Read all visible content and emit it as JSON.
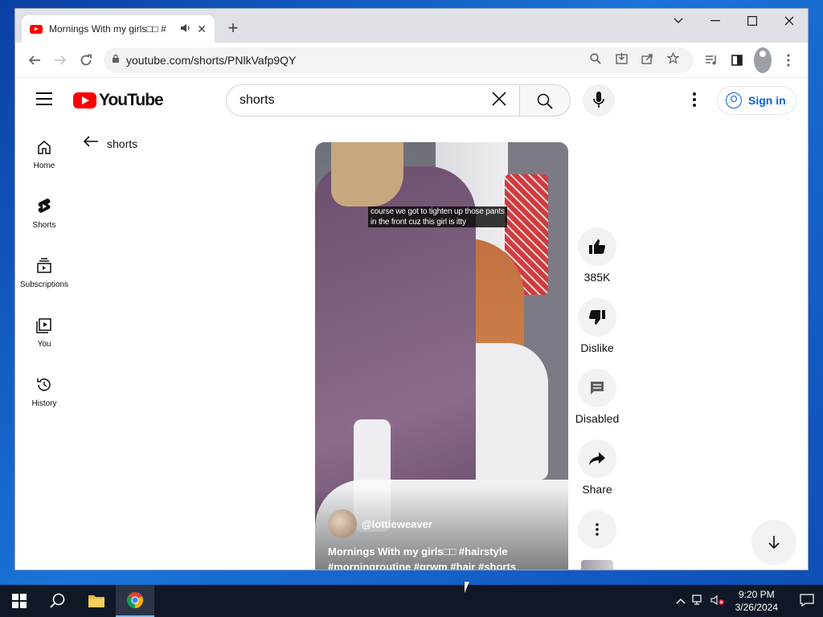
{
  "browser": {
    "tab": {
      "title": "Mornings With my girls□□ #"
    },
    "address_bar": {
      "url": "youtube.com/shorts/PNlkVafp9QY"
    }
  },
  "youtube": {
    "logo_text": "YouTube",
    "search": {
      "query": "shorts"
    },
    "sign_in_label": "Sign in",
    "sidebar": [
      {
        "label": "Home",
        "icon": "home-icon"
      },
      {
        "label": "Shorts",
        "icon": "shorts-icon"
      },
      {
        "label": "Subscriptions",
        "icon": "subscriptions-icon"
      },
      {
        "label": "You",
        "icon": "you-icon"
      },
      {
        "label": "History",
        "icon": "history-icon"
      }
    ],
    "back_label": "shorts",
    "video": {
      "caption_lines": [
        "course we got to tighten up those pants",
        "in the front cuz this girl is itty"
      ],
      "channel": "@lottieweaver",
      "title": "Mornings With my girls□□ #hairstyle #morningroutine #grwm #hair #shorts"
    },
    "actions": {
      "like_count": "385K",
      "dislike_label": "Dislike",
      "comments_label": "Disabled",
      "share_label": "Share"
    }
  },
  "taskbar": {
    "time": "9:20 PM",
    "date": "3/26/2024"
  },
  "colors": {
    "youtube_red": "#ff0000",
    "link_blue": "#065fd4",
    "taskbar": "#101827"
  }
}
